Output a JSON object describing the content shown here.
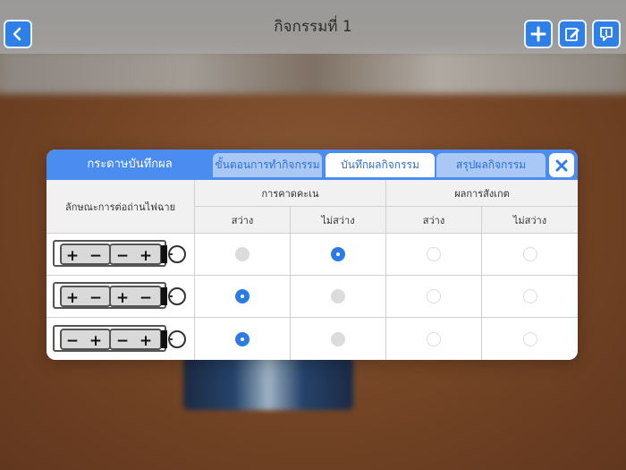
{
  "top_bar": {
    "title": "กิจกรรมที่ 1",
    "back_icon": "chevron-left-icon",
    "add_icon": "plus-icon",
    "edit_icon": "edit-icon",
    "info_icon": "info-icon",
    "accent": "#2f80e6"
  },
  "modal": {
    "title": "กระดาษบันทึกผล",
    "tabs": [
      {
        "label": "ขั้นตอนการทำกิจกรรม",
        "active": false
      },
      {
        "label": "บันทึกผลกิจกรรม",
        "active": true
      },
      {
        "label": "สรุปผลกิจกรรม",
        "active": false
      }
    ],
    "close_icon": "close-icon",
    "header_color": "#4a8cf0"
  },
  "table": {
    "row_header": "ลักษณะการต่อถ่านไฟฉาย",
    "group_prediction": "การคาดคะเน",
    "group_observation": "ผลการสังเกต",
    "col_bright": "สว่าง",
    "col_not_bright": "ไม่สว่าง",
    "rows": [
      {
        "circuit": [
          "+",
          "−",
          "−",
          "+"
        ],
        "prediction_bright": false,
        "prediction_not_bright": true
      },
      {
        "circuit": [
          "+",
          "−",
          "+",
          "−"
        ],
        "prediction_bright": true,
        "prediction_not_bright": false
      },
      {
        "circuit": [
          "−",
          "+",
          "−",
          "+"
        ],
        "prediction_bright": true,
        "prediction_not_bright": false
      }
    ]
  }
}
